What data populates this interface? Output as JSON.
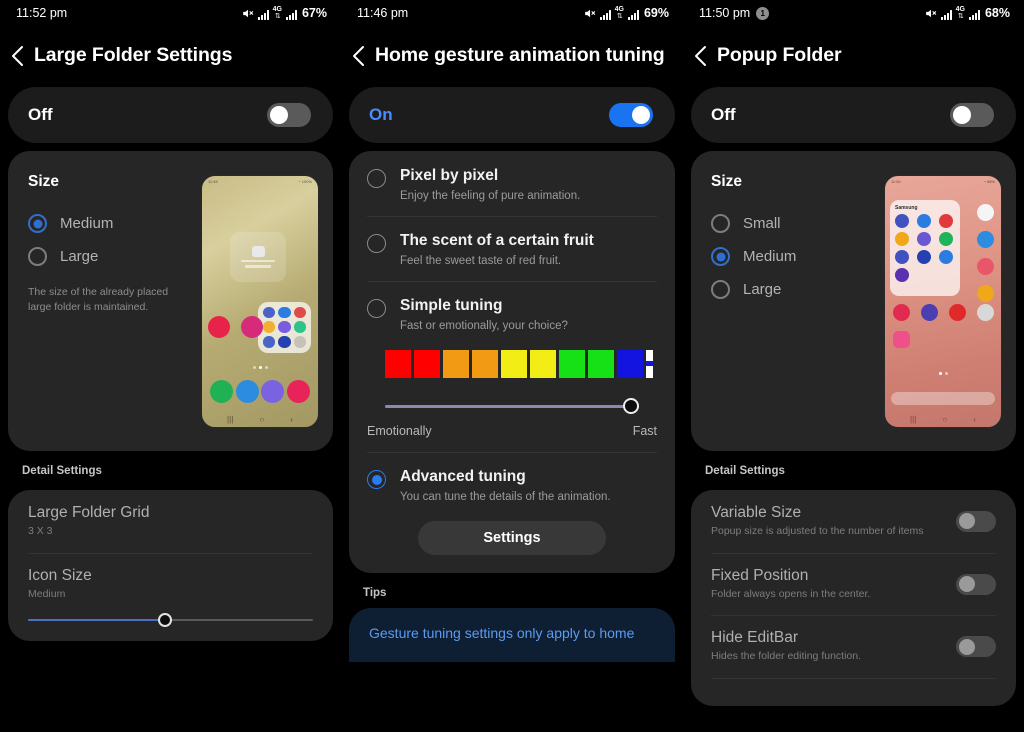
{
  "screens": [
    {
      "status": {
        "time": "11:52 pm",
        "battery": "67%",
        "network": "4G",
        "badge": null
      },
      "title": "Large Folder Settings",
      "master": {
        "label": "Off",
        "on": false
      },
      "size": {
        "heading": "Size",
        "options": [
          {
            "label": "Medium",
            "selected": true
          },
          {
            "label": "Large",
            "selected": false
          }
        ],
        "hint": "The size of the already placed large folder is maintained."
      },
      "detail": {
        "heading": "Detail Settings",
        "rows": [
          {
            "title": "Large Folder Grid",
            "sub": "3 X 3"
          },
          {
            "title": "Icon Size",
            "sub": "Medium",
            "slider": 48
          }
        ]
      }
    },
    {
      "status": {
        "time": "11:46 pm",
        "battery": "69%",
        "network": "4G",
        "badge": null
      },
      "title": "Home gesture animation tuning",
      "master": {
        "label": "On",
        "on": true
      },
      "options": [
        {
          "title": "Pixel by pixel",
          "sub": "Enjoy the feeling of pure animation.",
          "selected": false
        },
        {
          "title": "The scent of a certain fruit",
          "sub": "Feel the sweet taste of red fruit.",
          "selected": false
        },
        {
          "title": "Simple tuning",
          "sub": "Fast or emotionally, your choice?",
          "selected": false
        }
      ],
      "swatches": [
        "#ff0000",
        "#ff0000",
        "#f29a14",
        "#f29a14",
        "#f2ed14",
        "#f2ed14",
        "#16e016",
        "#16e016",
        "#1414e0"
      ],
      "tuning_slider": {
        "value": 100,
        "left_label": "Emotionally",
        "right_label": "Fast"
      },
      "advanced": {
        "title": "Advanced tuning",
        "sub": "You can tune the details of the animation.",
        "selected": true,
        "button": "Settings"
      },
      "tips": {
        "heading": "Tips",
        "text": "Gesture tuning settings only apply to home"
      }
    },
    {
      "status": {
        "time": "11:50 pm",
        "battery": "68%",
        "network": "4G",
        "badge": "1"
      },
      "title": "Popup Folder",
      "master": {
        "label": "Off",
        "on": false
      },
      "size": {
        "heading": "Size",
        "options": [
          {
            "label": "Small",
            "selected": false
          },
          {
            "label": "Medium",
            "selected": true
          },
          {
            "label": "Large",
            "selected": false
          }
        ]
      },
      "detail": {
        "heading": "Detail Settings",
        "rows": [
          {
            "title": "Variable Size",
            "sub": "Popup size is adjusted to the number of items",
            "toggle": false
          },
          {
            "title": "Fixed Position",
            "sub": "Folder always opens in the center.",
            "toggle": false
          },
          {
            "title": "Hide EditBar",
            "sub": "Hides the folder editing function.",
            "toggle": false
          }
        ]
      },
      "preview": {
        "folder_title": "Samsung"
      }
    }
  ],
  "colors": {
    "accent_blue": "#1a73f0",
    "card_bg": "#262626",
    "screen_bg": "#000000",
    "tips_bg": "#0f1f33"
  }
}
